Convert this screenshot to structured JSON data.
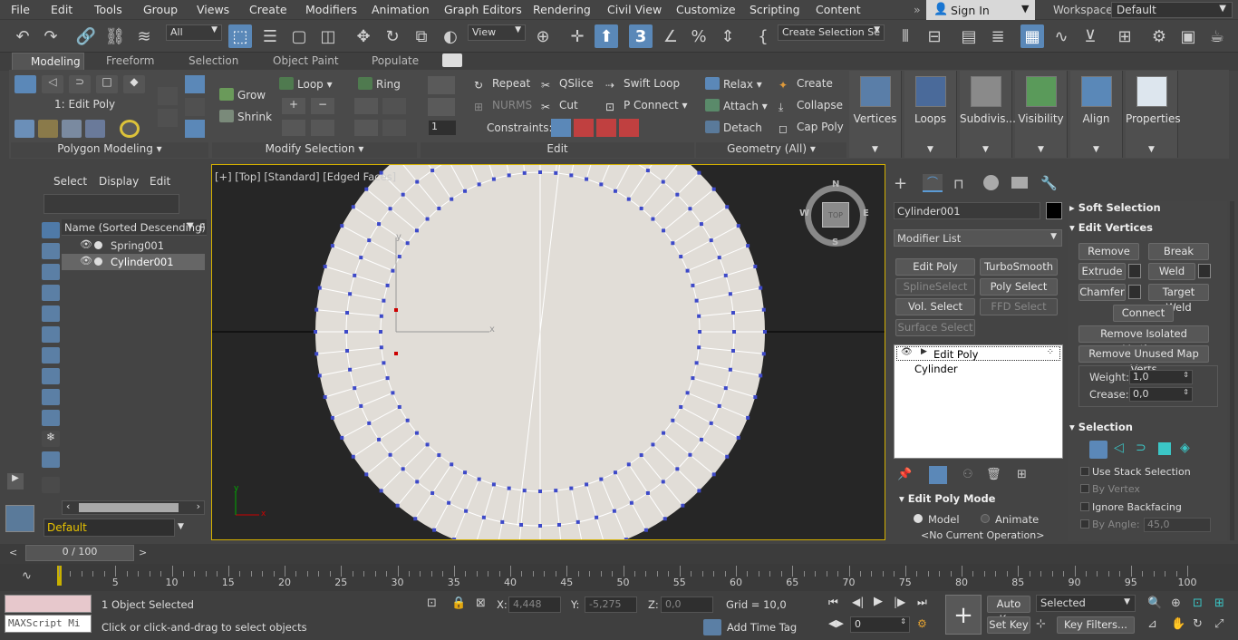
{
  "menu": {
    "items": [
      "File",
      "Edit",
      "Tools",
      "Group",
      "Views",
      "Create",
      "Modifiers",
      "Animation",
      "Graph Editors",
      "Rendering",
      "Civil View",
      "Customize",
      "Scripting",
      "Content"
    ],
    "signin": "Sign In",
    "workspaces_label": "Workspaces:",
    "workspace_value": "Default"
  },
  "toolbar": {
    "filter_value": "All",
    "coord_value": "View",
    "selection_set_placeholder": "Create Selection Se",
    "snap_label": "3"
  },
  "ribbon": {
    "tabs": [
      "Modeling",
      "Freeform",
      "Selection",
      "Object Paint",
      "Populate"
    ],
    "active_tab": "Modeling",
    "edit_poly_label": "1: Edit Poly",
    "grow": "Grow",
    "shrink": "Shrink",
    "loop": "Loop",
    "ring": "Ring",
    "repeat": "Repeat",
    "qslice": "QSlice",
    "swift_loop": "Swift Loop",
    "nurms": "NURMS",
    "cut": "Cut",
    "p_connect": "P Connect",
    "constraints": "Constraints:",
    "relax": "Relax",
    "create": "Create",
    "attach": "Attach",
    "collapse": "Collapse",
    "detach": "Detach",
    "cap_poly": "Cap Poly",
    "spinner_value": "1",
    "panels": {
      "polygon_modeling": "Polygon Modeling",
      "modify_selection": "Modify Selection",
      "edit": "Edit",
      "geometry_all": "Geometry (All)"
    },
    "big_buttons": [
      "Vertices",
      "Loops",
      "Subdivis...",
      "Visibility",
      "Align",
      "Properties"
    ]
  },
  "scene_explorer": {
    "tabs": [
      "Select",
      "Display",
      "Edit"
    ],
    "column_header": "Name (Sorted Descending)",
    "column_header_2": "F",
    "rows": [
      "Spring001",
      "Cylinder001"
    ],
    "selected_row": "Cylinder001",
    "layer": "Default"
  },
  "viewport": {
    "label_plus": "[+]",
    "label_view": "[Top]",
    "label_shading": "[Standard]",
    "label_faces": "[Edged Faces]",
    "viewcube_top": "TOP",
    "compass_n": "N",
    "compass_s": "S",
    "compass_e": "E",
    "compass_w": "W",
    "axis_x": "x",
    "axis_y": "y",
    "mini_axis_x": "x",
    "mini_axis_y": "y"
  },
  "command_panel": {
    "object_name": "Cylinder001",
    "modifier_list": "Modifier List",
    "buttons": [
      "Edit Poly",
      "TurboSmooth",
      "SplineSelect",
      "Poly Select",
      "Vol. Select",
      "FFD Select",
      "Surface Select"
    ],
    "stack": [
      "Edit Poly",
      "Cylinder"
    ],
    "edit_poly_mode": "Edit Poly Mode",
    "model": "Model",
    "animate": "Animate",
    "no_current_op": "<No Current Operation>",
    "soft_selection": "Soft Selection",
    "edit_vertices": "Edit Vertices",
    "remove": "Remove",
    "break": "Break",
    "extrude": "Extrude",
    "weld": "Weld",
    "chamfer": "Chamfer",
    "target_weld": "Target Weld",
    "connect": "Connect",
    "remove_isolated": "Remove Isolated Vertices",
    "remove_unused": "Remove Unused Map Verts",
    "weight_label": "Weight:",
    "weight_value": "1,0",
    "crease_label": "Crease:",
    "crease_value": "0,0",
    "selection": "Selection",
    "use_stack": "Use Stack Selection",
    "by_vertex": "By Vertex",
    "ignore_backfacing": "Ignore Backfacing",
    "by_angle": "By Angle:",
    "by_angle_value": "45,0"
  },
  "timeline": {
    "frame_display": "0 / 100",
    "ticks": [
      "5",
      "10",
      "15",
      "20",
      "25",
      "30",
      "35",
      "40",
      "45",
      "50",
      "55",
      "60",
      "65",
      "70",
      "75",
      "80",
      "85",
      "90",
      "95",
      "100"
    ]
  },
  "status": {
    "maxscript": "MAXScript Mi",
    "objects_selected": "1 Object Selected",
    "prompt": "Click or click-and-drag to select objects",
    "x_label": "X:",
    "x_value": "4,448",
    "y_label": "Y:",
    "y_value": "-5,275",
    "z_label": "Z:",
    "z_value": "0,0",
    "grid": "Grid = 10,0",
    "add_time_tag": "Add Time Tag",
    "auto_key": "Auto Key",
    "set_key": "Set Key",
    "selected": "Selected",
    "key_filters": "Key Filters...",
    "frame_value": "0"
  }
}
